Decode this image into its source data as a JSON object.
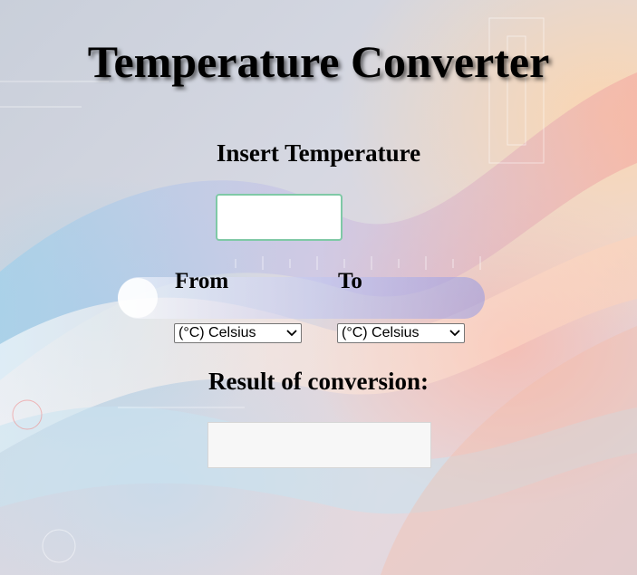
{
  "page": {
    "title": "Temperature Converter"
  },
  "input_section": {
    "label": "Insert Temperature",
    "value": ""
  },
  "conversion": {
    "from_label": "From",
    "to_label": "To",
    "from_selected": "(°C) Celsius",
    "to_selected": "(°C) Celsius"
  },
  "result": {
    "label": "Result of conversion:",
    "value": ""
  },
  "icons": {
    "dropdown": "chevron-down-icon"
  }
}
